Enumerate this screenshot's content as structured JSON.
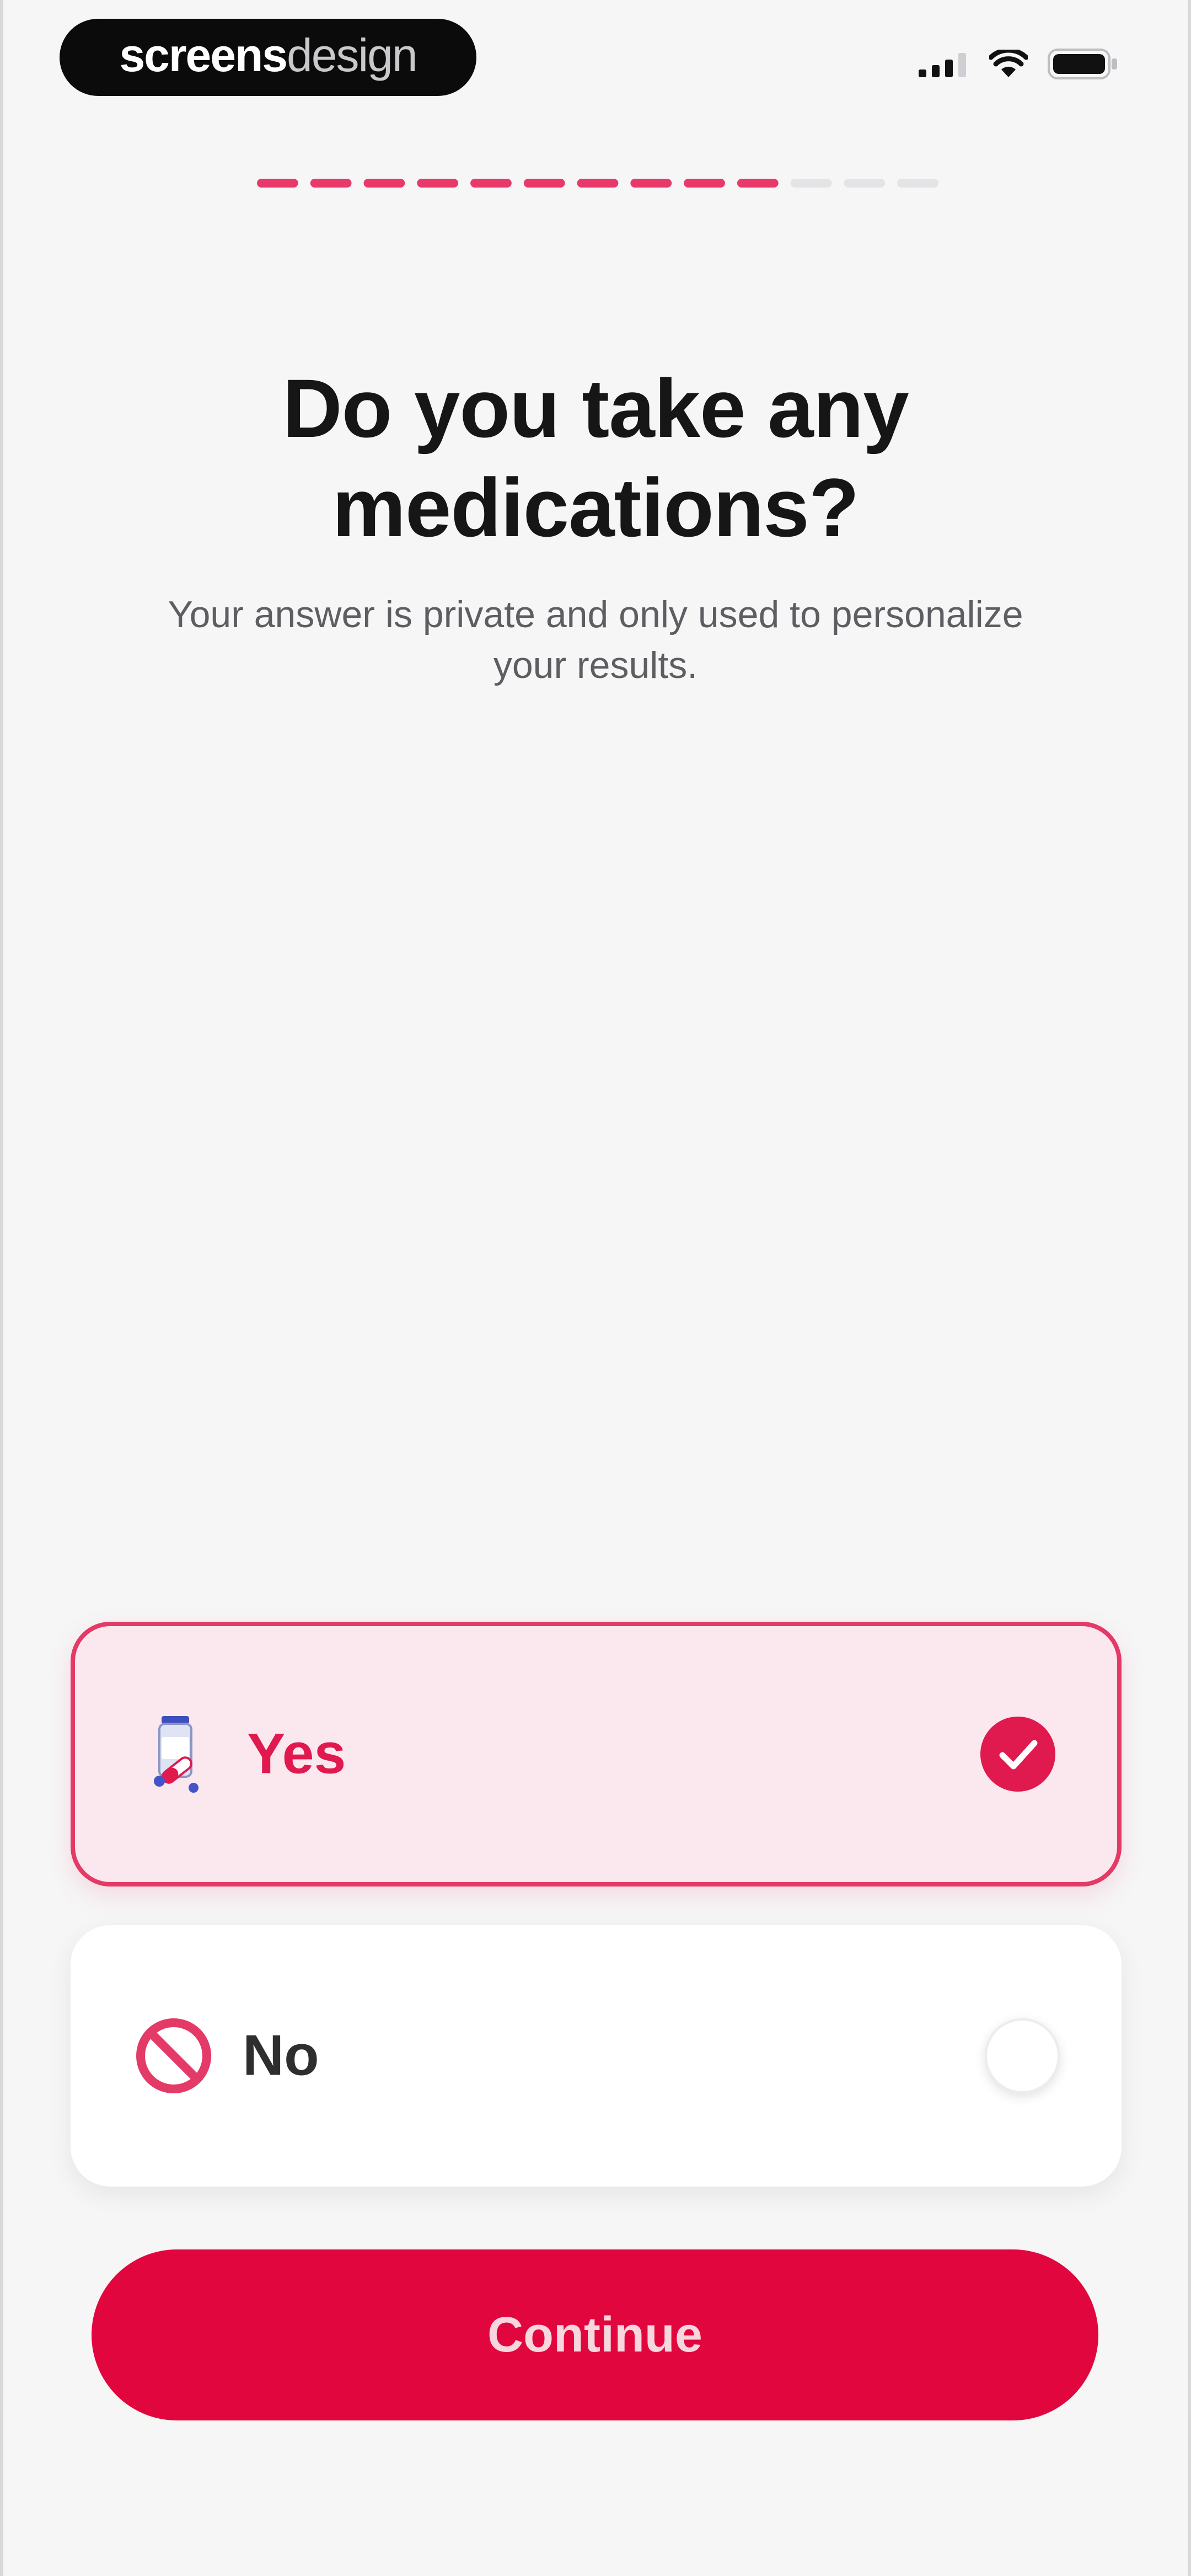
{
  "status_bar": {
    "brand_bold": "screens",
    "brand_light": "design",
    "icons": [
      "cellular-signal-icon",
      "wifi-icon",
      "battery-icon"
    ]
  },
  "progress": {
    "segments_total": 13,
    "segments_completed": 10,
    "active_color": "#e9386a",
    "inactive_color": "#e4e4e7"
  },
  "question": {
    "title_line1": "Do you take any",
    "title_line2": "medications?",
    "subtitle_line1": "Your answer is private and only used to personalize",
    "subtitle_line2": "your results."
  },
  "options": [
    {
      "label": "Yes",
      "icon": "medicine-bottle-icon",
      "selected": true
    },
    {
      "label": "No",
      "icon": "prohibited-icon",
      "selected": false
    }
  ],
  "continue_button": {
    "label": "Continue",
    "color": "#e2063f"
  },
  "colors": {
    "accent": "#e43a67",
    "selected_bg": "#fbe8ee",
    "background": "#f6f6f7"
  }
}
